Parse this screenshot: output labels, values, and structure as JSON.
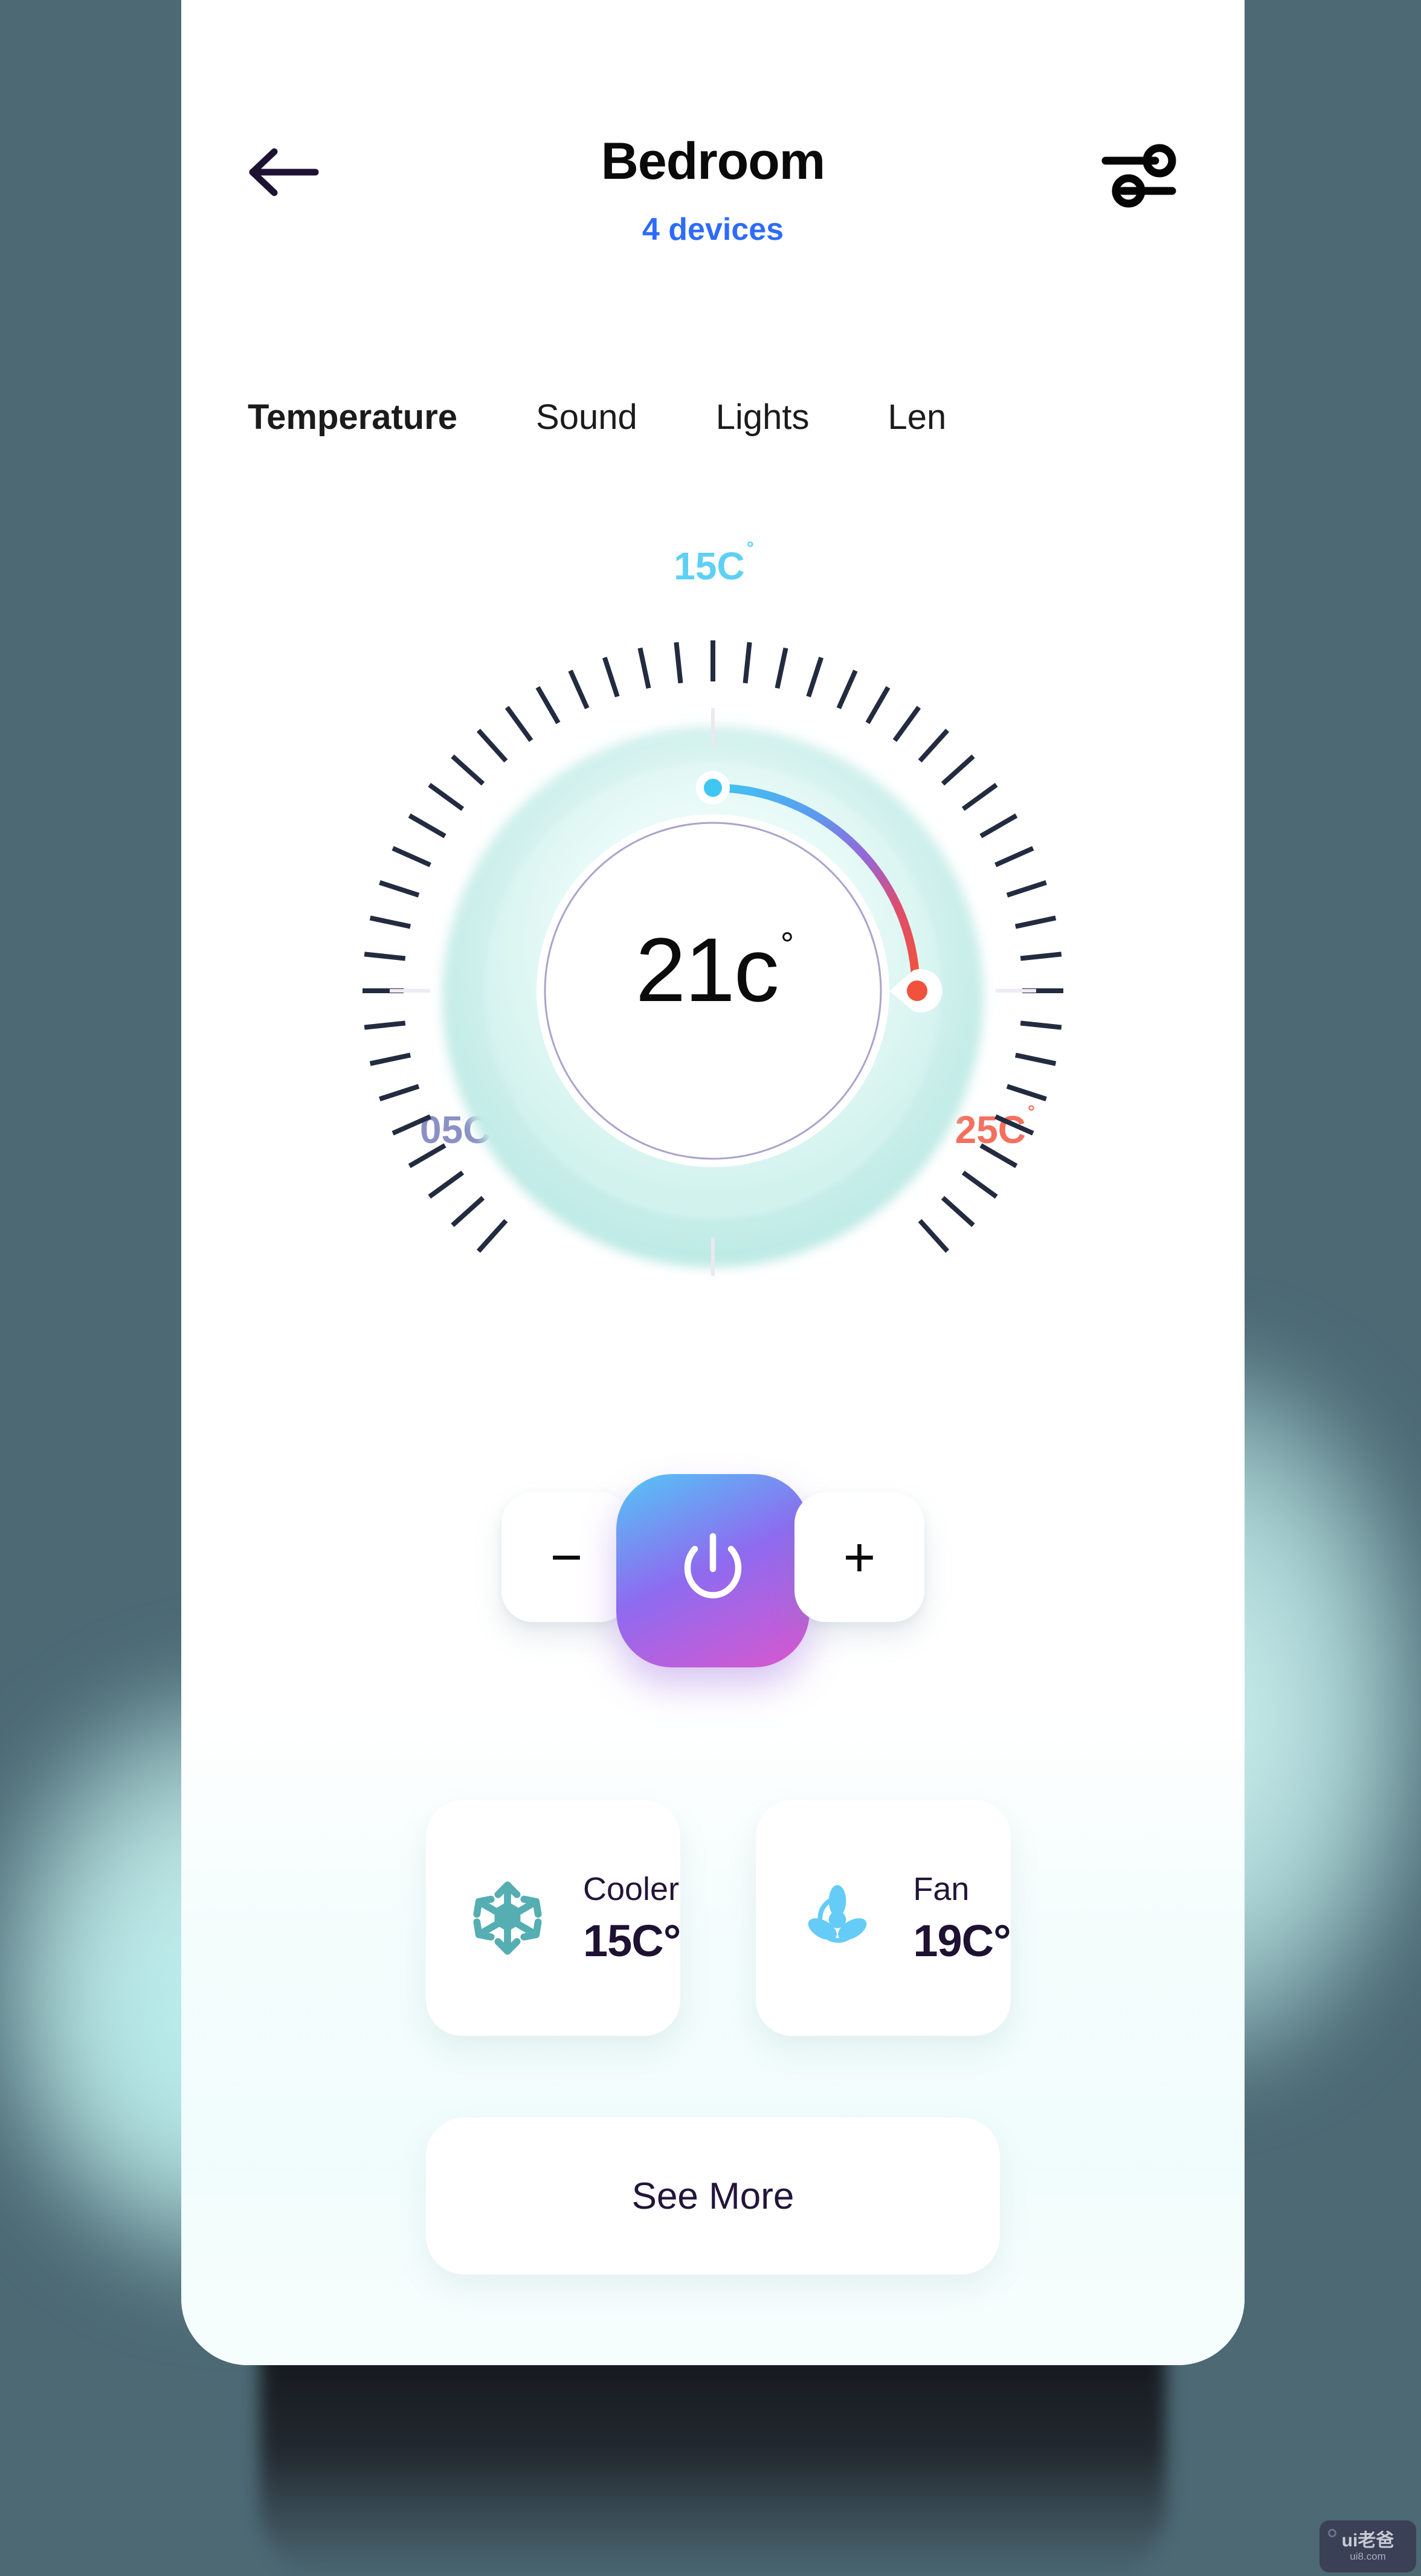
{
  "background": {
    "page_color": "#4C6974",
    "glow_color": "#D6F8F6"
  },
  "header": {
    "back_icon": "arrow-left-icon",
    "title": "Bedroom",
    "subtitle": "4 devices",
    "subtitle_color": "#2E6BFB",
    "settings_icon": "sliders-icon"
  },
  "tabs": [
    {
      "label": "Temperature",
      "active": true
    },
    {
      "label": "Sound",
      "active": false
    },
    {
      "label": "Lights",
      "active": false
    },
    {
      "label": "Len",
      "active": false
    }
  ],
  "dial": {
    "current_value": "21c",
    "degree_symbol": "°",
    "max_label": "25C",
    "max_color": "#F4705E",
    "min_label": "05C",
    "min_color": "#8B90C4",
    "top_label": "15C",
    "top_color": "#5DD0F6",
    "ring_color": "#CFF0EC",
    "tick_color": "#232B40",
    "tick_count": 60,
    "arc_gradient_start": "#3FC6F2",
    "arc_gradient_mid": "#7B6FE0",
    "arc_gradient_end": "#F0523E",
    "start_handle_icon": "dial-start-handle",
    "end_handle_icon": "dial-pointer-handle"
  },
  "controls": {
    "decrease_label": "−",
    "decrease_icon": "minus-icon",
    "power_icon": "power-icon",
    "increase_label": "+",
    "increase_icon": "plus-icon",
    "power_gradient_start": "#53C6F5",
    "power_gradient_mid": "#8E6BF0",
    "power_gradient_end": "#D957CE"
  },
  "devices": [
    {
      "icon": "snowflake-icon",
      "icon_color": "#55AEB2",
      "label": "Cooler",
      "value": "15C°"
    },
    {
      "icon": "fan-icon",
      "icon_color": "#64CCF7",
      "label": "Fan",
      "value": "19C°"
    }
  ],
  "see_more": {
    "label": "See More"
  },
  "watermark": {
    "brand": "ui老爸",
    "domain": "ui8.com"
  }
}
